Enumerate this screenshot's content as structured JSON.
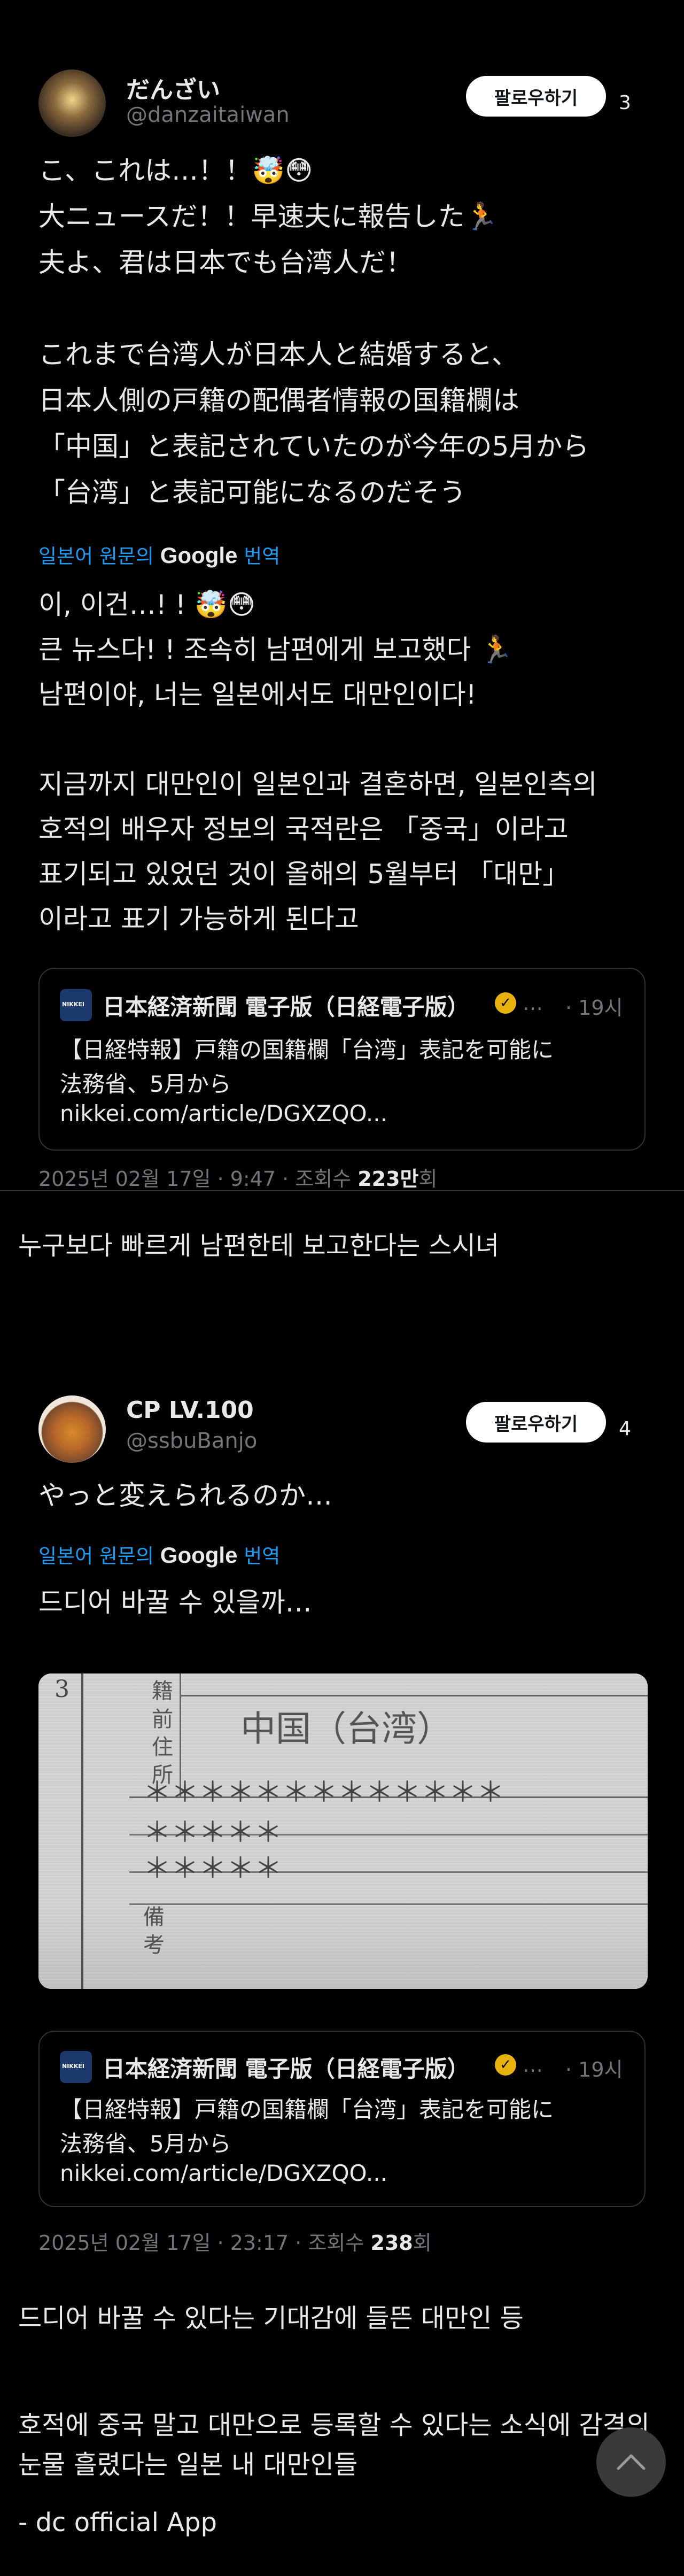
{
  "tweets": [
    {
      "display_name": "だんざい",
      "handle": "@danzaitaiwan",
      "follow_label": "팔로우하기",
      "thread_count": "3",
      "body_lines": [
        "こ、これは…！！🤯😳",
        "大ニュースだ！！早速夫に報告した🏃",
        "夫よ、君は日本でも台湾人だ！",
        "",
        "これまで台湾人が日本人と結婚すると、",
        "日本人側の戸籍の配偶者情報の国籍欄は",
        "「中国」と表記されていたのが今年の5月から",
        "「台湾」と表記可能になるのだそう"
      ],
      "translate": {
        "prefix": "일본어 원문의",
        "brand": "Google",
        "suffix": "번역"
      },
      "translated_lines": [
        "이, 이건…! ! 🤯😳",
        "큰 뉴스다! ! 조속히 남편에게 보고했다 🏃",
        "남편이야, 너는 일본에서도 대만인이다!",
        "",
        "지금까지 대만인이 일본인과 결혼하면, 일본인측의",
        "호적의 배우자 정보의 국적란은 「중국」이라고",
        "표기되고 있었던 것이 올해의 5월부터 「대만」",
        "이라고 표기 가능하게 된다고"
      ],
      "link_card": {
        "logo_text": "NIKKEI",
        "source": "日本経済新聞 電子版（日経電子版）",
        "ellipsis": "…",
        "time": "· 19시",
        "headline_1": "【日経特報】戸籍の国籍欄「台湾」表記を可能に",
        "headline_2": "法務省、5月から",
        "url": "nikkei.com/article/DGXZQO..."
      },
      "meta_date": "2025년 02월 17일 · 9:47 · 조회수 ",
      "meta_views": "223만",
      "meta_suffix": "회"
    },
    {
      "display_name": "CP LV.100",
      "handle": "@ssbuBanjo",
      "follow_label": "팔로우하기",
      "thread_count": "4",
      "body_lines": [
        "やっと変えられるのか…"
      ],
      "translate": {
        "prefix": "일본어 원문의",
        "brand": "Google",
        "suffix": "번역"
      },
      "translated_lines": [
        "드디어 바꿀 수 있을까…"
      ],
      "photo": {
        "row_number": "3",
        "field_1": "籍",
        "field_2": "前住所",
        "value": "中国（台湾）",
        "stars_1": "＊＊＊＊＊＊＊＊＊＊＊＊＊",
        "stars_2": "＊＊＊＊＊",
        "stars_3": "＊＊＊＊＊",
        "field_3": "備考"
      },
      "link_card": {
        "logo_text": "NIKKEI",
        "source": "日本経済新聞 電子版（日経電子版）",
        "ellipsis": "…",
        "time": "· 19시",
        "headline_1": "【日経特報】戸籍の国籍欄「台湾」表記を可能に",
        "headline_2": "法務省、5月から",
        "url": "nikkei.com/article/DGXZQO..."
      },
      "meta_date": "2025년 02월 17일 · 23:17 · 조회수 ",
      "meta_views": "238",
      "meta_suffix": "회"
    }
  ],
  "captions": {
    "after_tweet_1": "누구보다 빠르게 남편한테 보고한다는 스시녀",
    "after_tweet_2": "드디어 바꿀 수 있다는 기대감에 들뜬 대만인 등",
    "line_3a": "호적에 중국 말고 대만으로 등록할 수 있다는 소식에 감격의",
    "line_3b": "눈물 흘렸다는 일본 내 대만인들",
    "footer": "- dc official App"
  },
  "icons": {
    "scroll_top": "chevron-up-icon",
    "verified": "verified-badge-icon"
  },
  "colors": {
    "link_blue": "#1d9bf0",
    "muted": "#71767b",
    "badge_gold": "#e8b10d"
  }
}
